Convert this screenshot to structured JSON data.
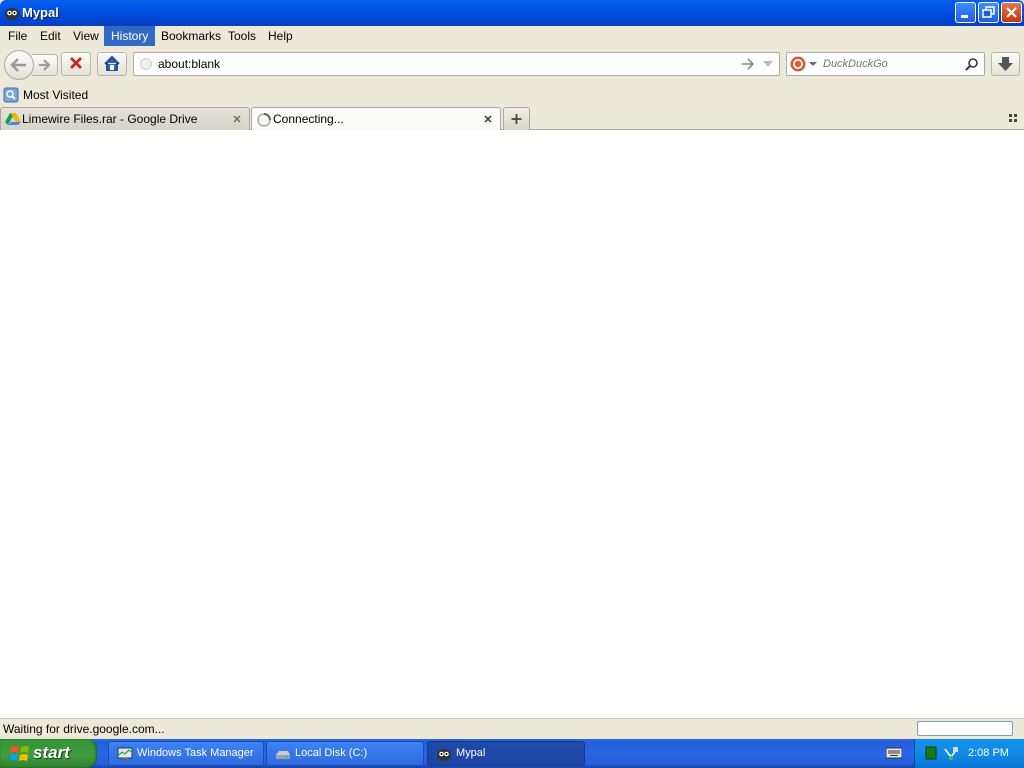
{
  "window": {
    "title": "Mypal",
    "controls": [
      "minimize",
      "restore",
      "close"
    ]
  },
  "menu": [
    {
      "label": "File",
      "accel": "F"
    },
    {
      "label": "Edit",
      "accel": "E"
    },
    {
      "label": "View",
      "accel": "V"
    },
    {
      "label": "History",
      "accel": "H",
      "active": true
    },
    {
      "label": "Bookmarks",
      "accel": "B"
    },
    {
      "label": "Tools",
      "accel": "T"
    },
    {
      "label": "Help",
      "accel": "H"
    }
  ],
  "navbar": {
    "url": "about:blank",
    "search_placeholder": "DuckDuckGo"
  },
  "bookmarks": [
    {
      "label": "Most Visited",
      "icon": "bookmarks-folder-icon"
    }
  ],
  "tabs": [
    {
      "title": "Limewire Files.rar - Google Drive",
      "icon": "google-drive-icon",
      "selected": false
    },
    {
      "title": "Connecting...",
      "icon": "loading-throbber-icon",
      "selected": true
    }
  ],
  "status": {
    "text": "Waiting for drive.google.com..."
  },
  "taskbar": {
    "start_label": "start",
    "items": [
      {
        "label": "Windows Task Manager",
        "icon": "task-manager-icon",
        "active": false
      },
      {
        "label": "Local Disk (C:)",
        "icon": "drive-icon",
        "active": false
      },
      {
        "label": "Mypal",
        "icon": "mypal-icon",
        "active": true
      }
    ],
    "clock": "2:08 PM"
  },
  "colors": {
    "titlebar": "#0058ee",
    "menu_highlight": "#316ac5",
    "taskbar": "#245edb",
    "start_button": "#3c9a3c",
    "tray": "#0f8be6",
    "close_button": "#c5350e"
  }
}
